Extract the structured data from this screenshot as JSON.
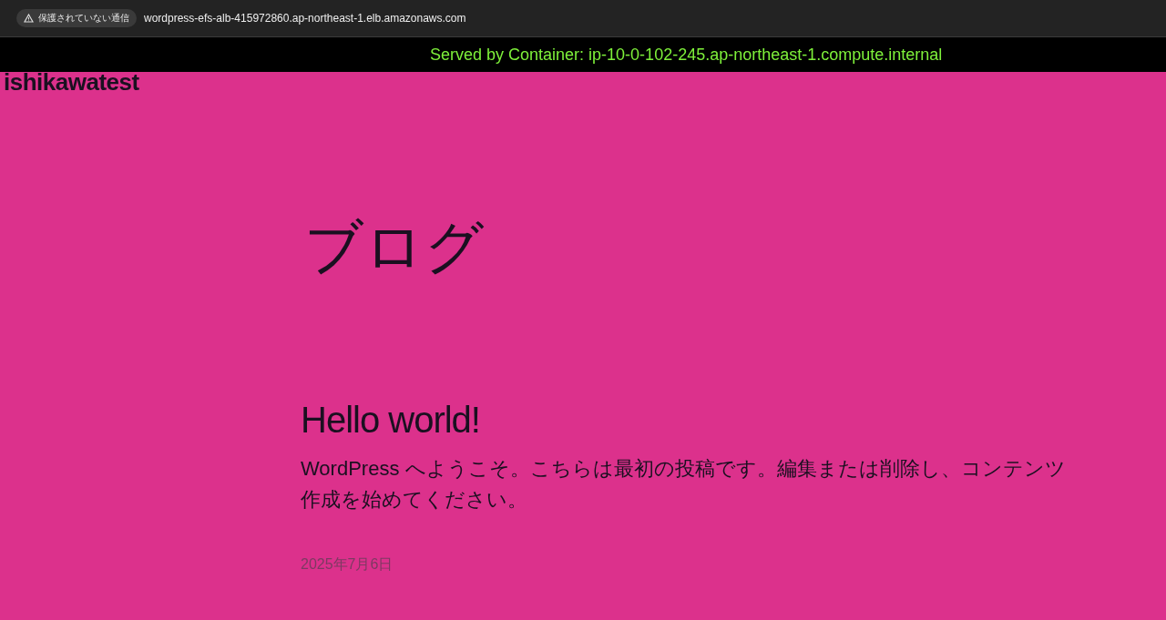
{
  "browser": {
    "security_label": "保護されていない通信",
    "url": "wordpress-efs-alb-415972860.ap-northeast-1.elb.amazonaws.com"
  },
  "banner": {
    "text": "Served by Container: ip-10-0-102-245.ap-northeast-1.compute.internal"
  },
  "site_title": "ishikawatest",
  "page_title": "ブログ",
  "posts": [
    {
      "title": "Hello world!",
      "excerpt": "WordPress へようこそ。こちらは最初の投稿です。編集または削除し、コンテンツ作成を始めてください。",
      "date": "2025年7月6日"
    }
  ]
}
